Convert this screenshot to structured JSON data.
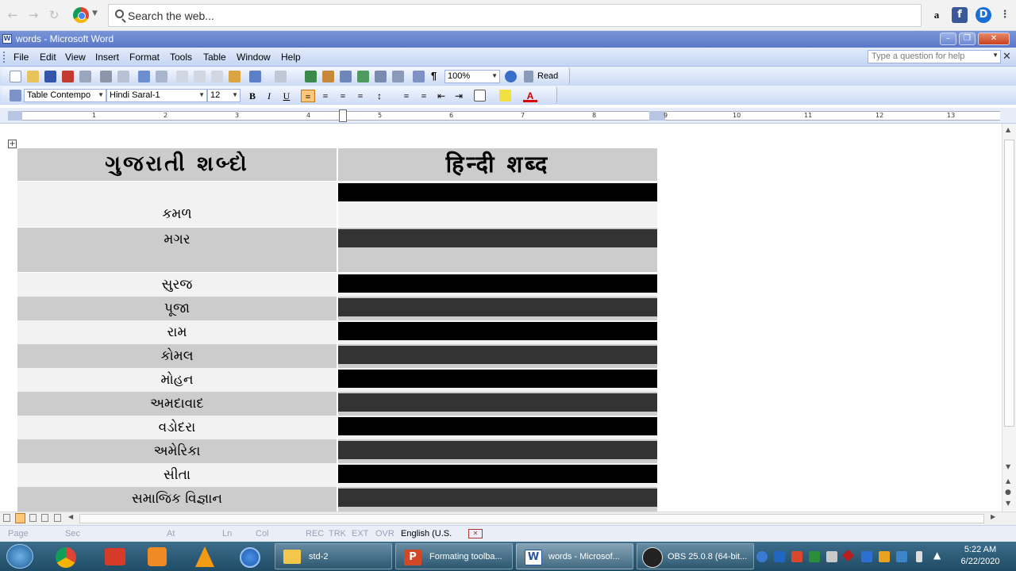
{
  "browser": {
    "search_placeholder": "Search the web...",
    "extensions": [
      "amazon-icon",
      "facebook-icon",
      "dashlane-icon"
    ]
  },
  "window": {
    "title": "words - Microsoft Word"
  },
  "menu": {
    "items": [
      "File",
      "Edit",
      "View",
      "Insert",
      "Format",
      "Tools",
      "Table",
      "Window",
      "Help"
    ],
    "question_placeholder": "Type a question for help"
  },
  "toolbar": {
    "zoom": "100%",
    "read_label": "Read"
  },
  "format": {
    "style": "Table Contempo",
    "font": "Hindi Saral-1",
    "size": "12",
    "bold": "B",
    "italic": "I",
    "underline": "U",
    "font_color_letter": "A"
  },
  "ruler": {
    "numbers": [
      "1",
      "2",
      "3",
      "4",
      "5",
      "6",
      "7",
      "8",
      "9",
      "10",
      "11",
      "12",
      "13"
    ]
  },
  "table": {
    "header_gujarati": "ગુજરાતી શબ્દો",
    "header_hindi": "हिन्दी शब्द",
    "rows": [
      "કમળ",
      "મગર",
      "સુરજ",
      "પૂજા",
      "રામ",
      "કોમલ",
      "મોહન",
      "અમદાવાદ",
      "વડોદરા",
      "અમેરિકા",
      "સીતા",
      "સમાજિક વિજ્ઞાન"
    ]
  },
  "statusbar": {
    "page": "Page",
    "sec": "Sec",
    "at": "At",
    "ln": "Ln",
    "col": "Col",
    "rec": "REC",
    "trk": "TRK",
    "ext": "EXT",
    "ovr": "OVR",
    "language": "English (U.S."
  },
  "taskbar": {
    "tasks": [
      "std-2",
      "Formating toolba...",
      "words - Microsof...",
      "OBS 25.0.8 (64-bit..."
    ],
    "time": "5:22 AM",
    "date": "6/22/2020"
  },
  "colors": {
    "title_blue": "#5a78c8",
    "cell_grey": "#cccccc",
    "cell_light": "#f2f2f2",
    "bar_black": "#000000",
    "bar_dark": "#333333"
  }
}
